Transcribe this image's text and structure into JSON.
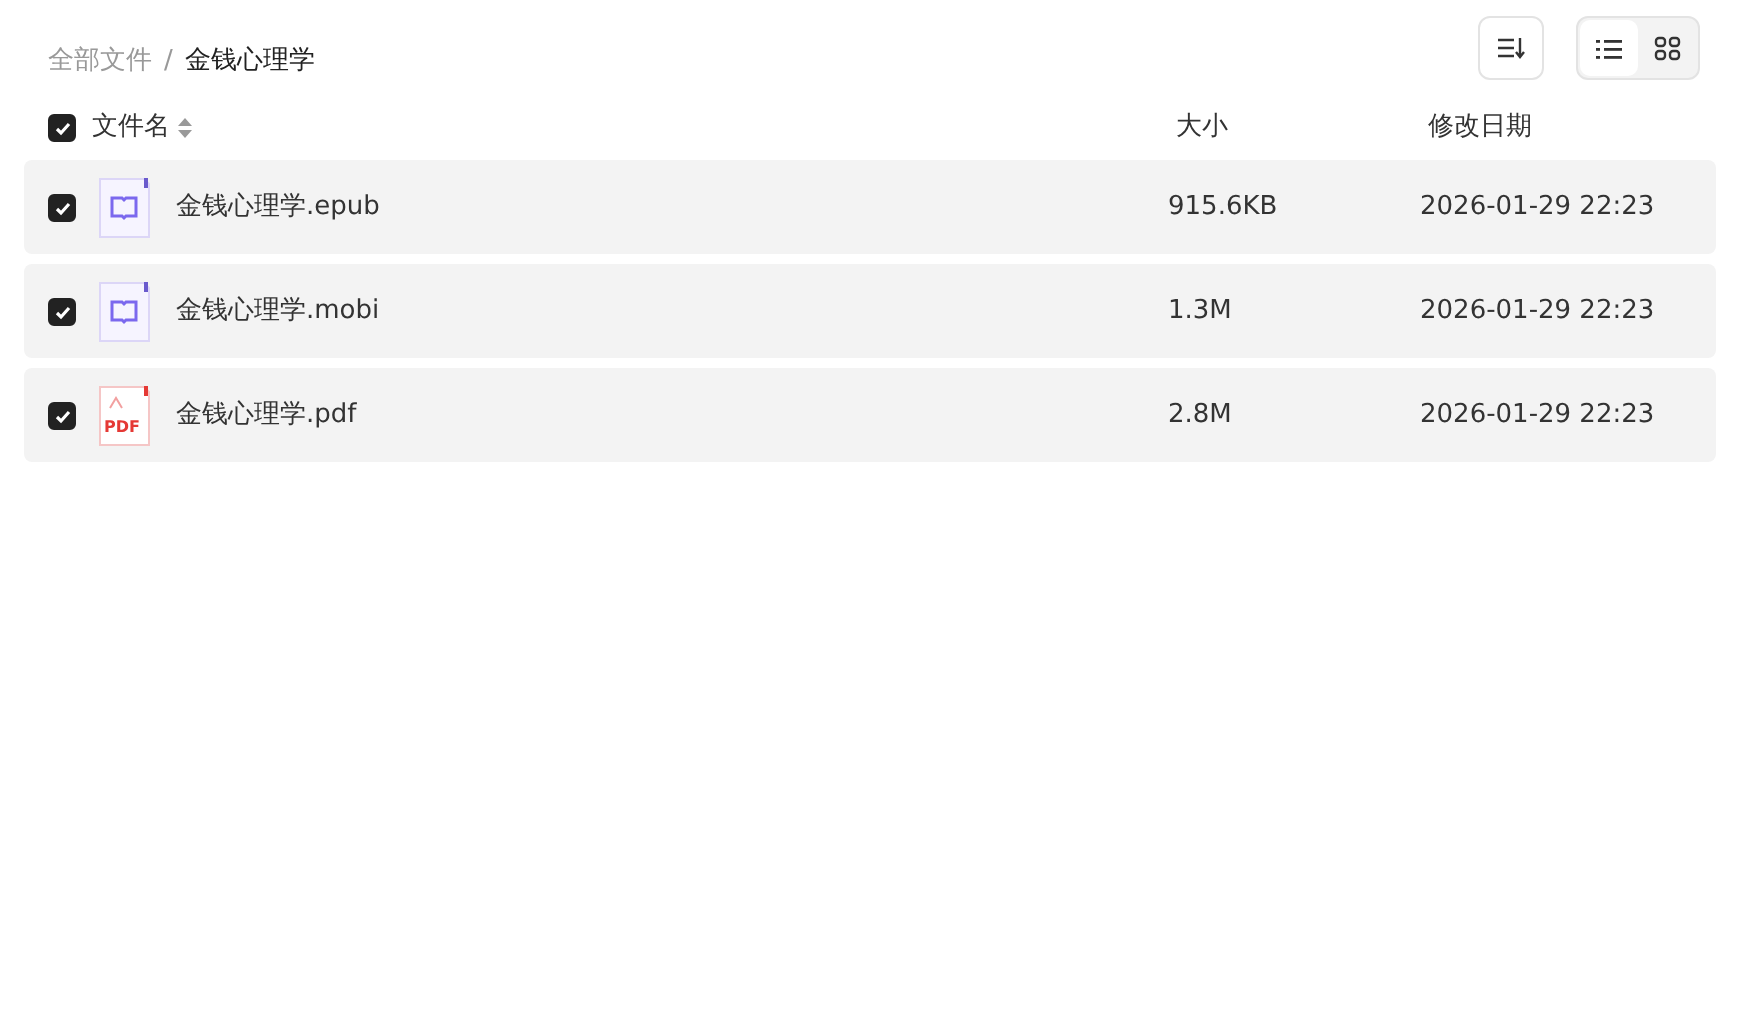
{
  "breadcrumb": [
    {
      "label": "全部文件",
      "current": false
    },
    {
      "label": "/",
      "kind": "separator"
    },
    {
      "label": "金钱心理学",
      "current": true
    }
  ],
  "toolbar": {
    "view_modes": [
      {
        "kind": "list",
        "selected": true
      },
      {
        "kind": "grid",
        "selected": false
      }
    ]
  },
  "table": {
    "all_checked": true,
    "columns": [
      {
        "label": "文件名",
        "sortable": true
      },
      {
        "label": "大小",
        "sortable": false
      },
      {
        "label": "修改日期",
        "sortable": false
      }
    ],
    "rows": [
      {
        "checked": true,
        "kind": "ebook",
        "name": "金钱心理学.epub",
        "size": "915.6KB",
        "modified": "2026-01-29 22:23"
      },
      {
        "checked": true,
        "kind": "ebook",
        "name": "金钱心理学.mobi",
        "size": "1.3M",
        "modified": "2026-01-29 22:23"
      },
      {
        "checked": true,
        "kind": "pdf",
        "icon_label": "PDF",
        "name": "金钱心理学.pdf",
        "size": "2.8M",
        "modified": "2026-01-29 22:23"
      }
    ]
  }
}
